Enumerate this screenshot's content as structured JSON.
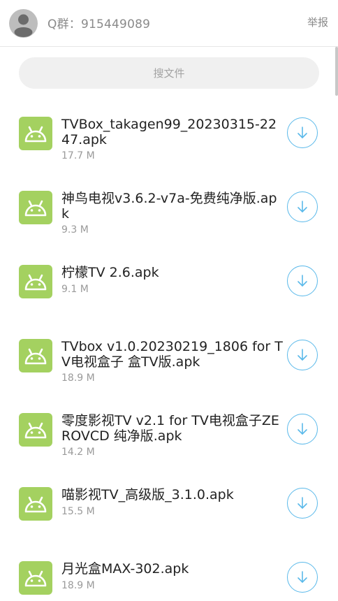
{
  "header": {
    "group_label": "Q群：915449089",
    "report_label": "举报"
  },
  "search": {
    "placeholder": "搜文件"
  },
  "files": [
    {
      "name": "TVBox_takagen99_20230315-2247.apk",
      "size": "17.7 M",
      "icon": "android-icon"
    },
    {
      "name": "神鸟电视v3.6.2-v7a-免费纯净版.apk",
      "size": "9.3 M",
      "icon": "android-icon"
    },
    {
      "name": "柠檬TV 2.6.apk",
      "size": "9.1 M",
      "icon": "android-icon"
    },
    {
      "name": "TVbox v1.0.20230219_1806 for TV电视盒子 盒TV版.apk",
      "size": "18.9 M",
      "icon": "android-icon"
    },
    {
      "name": "零度影视TV v2.1 for TV电视盒子ZEROVCD 纯净版.apk",
      "size": "14.2 M",
      "icon": "android-icon"
    },
    {
      "name": "喵影视TV_高级版_3.1.0.apk",
      "size": "15.5 M",
      "icon": "android-icon"
    },
    {
      "name": "月光盒MAX-302.apk",
      "size": "18.9 M",
      "icon": "android-icon"
    }
  ],
  "colors": {
    "accent": "#5ab9ea",
    "android_green": "#a4d160",
    "text_primary": "#222222",
    "text_secondary": "#9a9a9a"
  }
}
